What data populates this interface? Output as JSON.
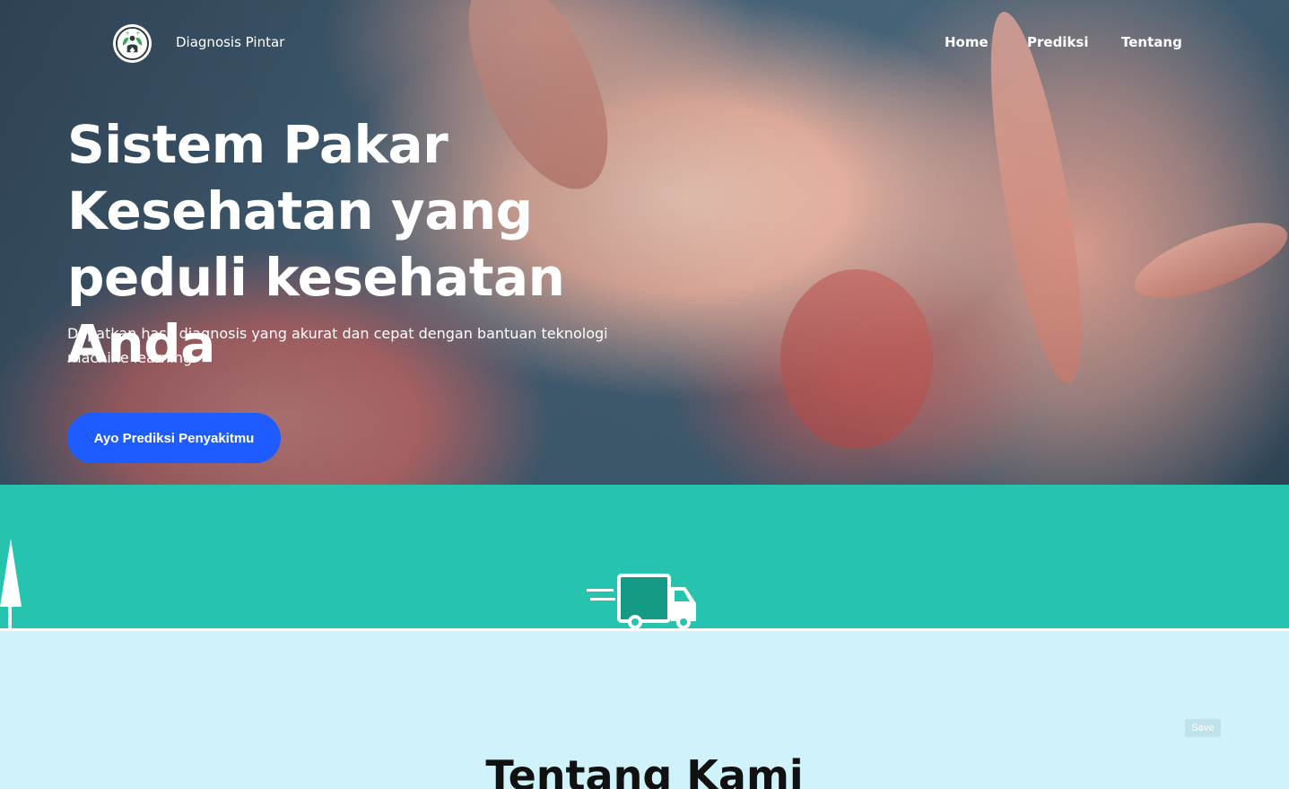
{
  "nav": {
    "brand": "Diagnosis Pintar",
    "links": [
      {
        "label": "Home"
      },
      {
        "label": "Prediksi"
      },
      {
        "label": "Tentang"
      }
    ]
  },
  "hero": {
    "title": "Sistem Pakar Kesehatan yang peduli kesehatan Anda",
    "subtitle": "Dapatkan hasil diagnosis yang akurat dan cepat dengan bantuan teknologi machine learning.",
    "cta_label": "Ayo Prediksi Penyakitmu"
  },
  "about": {
    "title": "Tentang Kami",
    "save_label": "Save"
  },
  "icons": {
    "logo": "medical-logo-icon",
    "tree": "tree-icon",
    "truck": "delivery-truck-icon"
  },
  "colors": {
    "cta": "#1f5cff",
    "band": "#26c4ae",
    "about_bg": "#d0f3fb",
    "truck_body": "#159a86"
  }
}
